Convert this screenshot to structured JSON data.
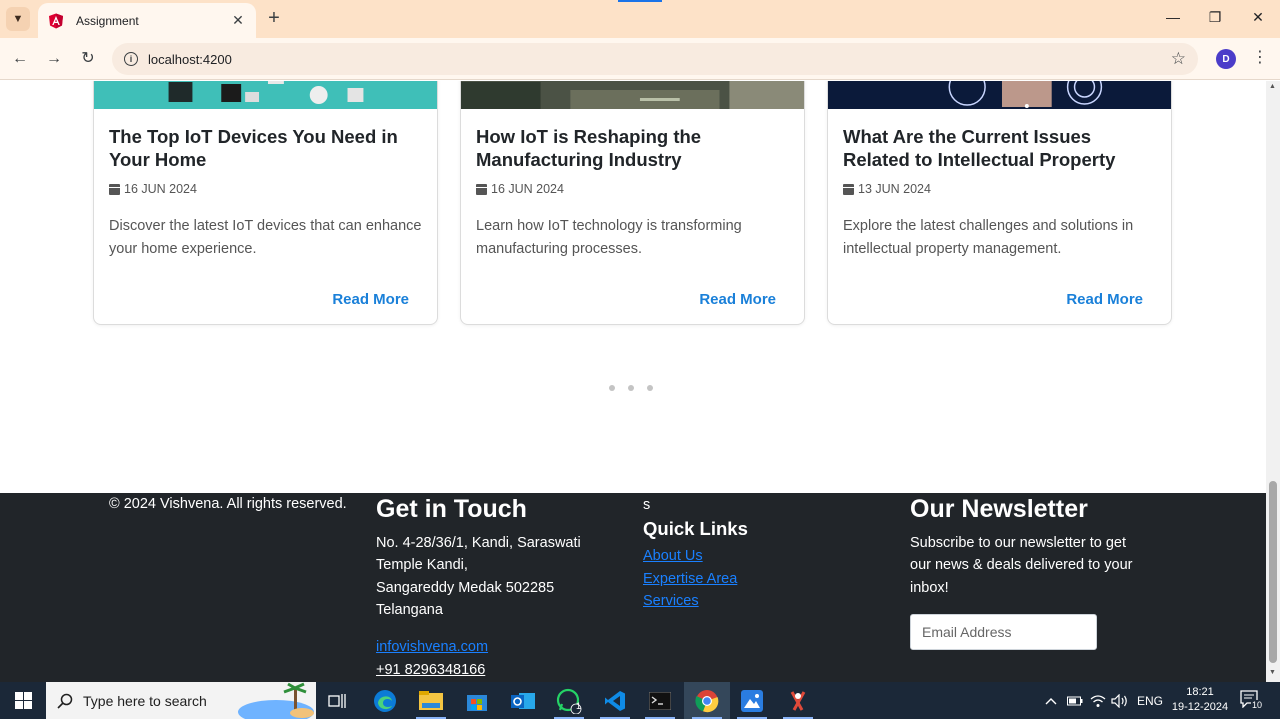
{
  "browser": {
    "tab_title": "Assignment",
    "url": "localhost:4200",
    "profile_initial": "D"
  },
  "cards": [
    {
      "title": "The Top IoT Devices You Need in Your Home",
      "date": "16 JUN 2024",
      "description": "Discover the latest IoT devices that can enhance your home experience.",
      "link": "Read More"
    },
    {
      "title": "How IoT is Reshaping the Manufacturing Industry",
      "date": "16 JUN 2024",
      "description": "Learn how IoT technology is transforming manufacturing processes.",
      "link": "Read More"
    },
    {
      "title": "What Are the Current Issues Related to Intellectual Property",
      "date": "13 JUN 2024",
      "description": "Explore the latest challenges and solutions in intellectual property management.",
      "link": "Read More"
    }
  ],
  "footer": {
    "copyright": "© 2024 Vishvena. All rights reserved.",
    "contact": {
      "heading": "Get in Touch",
      "address_1": "No. 4-28/36/1, Kandi, Saraswati",
      "address_2": "Temple Kandi,",
      "address_3": "Sangareddy Medak 502285",
      "address_4": "Telangana",
      "email": "infovishvena.com",
      "phone": "+91 8296348166"
    },
    "quick_links": {
      "stray": "s",
      "heading": "Quick Links",
      "items": [
        "About Us",
        "Expertise Area",
        "Services"
      ]
    },
    "newsletter": {
      "heading": "Our Newsletter",
      "line_1": "Subscribe to our newsletter to get",
      "line_2": "our news & deals delivered to your",
      "line_3": "inbox!",
      "placeholder": "Email Address"
    }
  },
  "taskbar": {
    "search_placeholder": "Type here to search",
    "whatsapp_badge": "1",
    "language": "ENG",
    "time": "18:21",
    "date": "19-12-2024",
    "notification_count": "10"
  }
}
